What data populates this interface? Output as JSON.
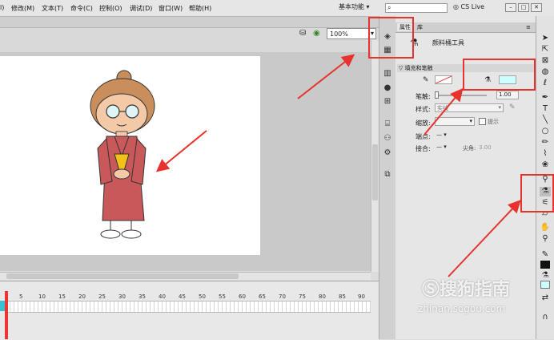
{
  "menubar": {
    "items": [
      "l)",
      "修改(M)",
      "文本(T)",
      "命令(C)",
      "控制(O)",
      "调试(D)",
      "窗口(W)",
      "帮助(H)"
    ],
    "workspace": "基本功能",
    "cs_live": "CS Live",
    "search_placeholder": ""
  },
  "editbar": {
    "zoom": "100%"
  },
  "panel": {
    "tabs": [
      "属性",
      "库"
    ],
    "tool_name": "颜料桶工具",
    "section_title": "填充和笔触",
    "stroke_label": "笔触:",
    "stroke_value": "1.00",
    "style_label": "样式:",
    "style_value": "实线",
    "scale_label": "缩放:",
    "hint_label": "提示",
    "cap_label": "端点:",
    "join_label": "接合:",
    "miter_label": "尖角:",
    "miter_value": "3.00"
  },
  "timeline": {
    "ticks": [
      "5",
      "10",
      "15",
      "20",
      "25",
      "30",
      "35",
      "40",
      "45",
      "50",
      "55",
      "60",
      "65",
      "70",
      "75",
      "80",
      "85",
      "90"
    ]
  },
  "watermark": {
    "brand": "搜狗指南",
    "url": "zhinan.sogou.com"
  },
  "colors": {
    "fill_swatch": "#ccffff",
    "stroke_swatch": "#ffffff",
    "annotation": "#e8322e"
  },
  "icons": [
    "pencil-icon",
    "paint-bucket-icon",
    "arrow-icon",
    "subselect-icon",
    "free-transform-icon",
    "lasso-icon",
    "pen-icon",
    "text-icon",
    "line-icon",
    "rectangle-icon",
    "brush-icon",
    "bone-icon",
    "ink-bottle-icon",
    "eyedropper-icon",
    "eraser-icon",
    "hand-icon",
    "zoom-icon"
  ]
}
